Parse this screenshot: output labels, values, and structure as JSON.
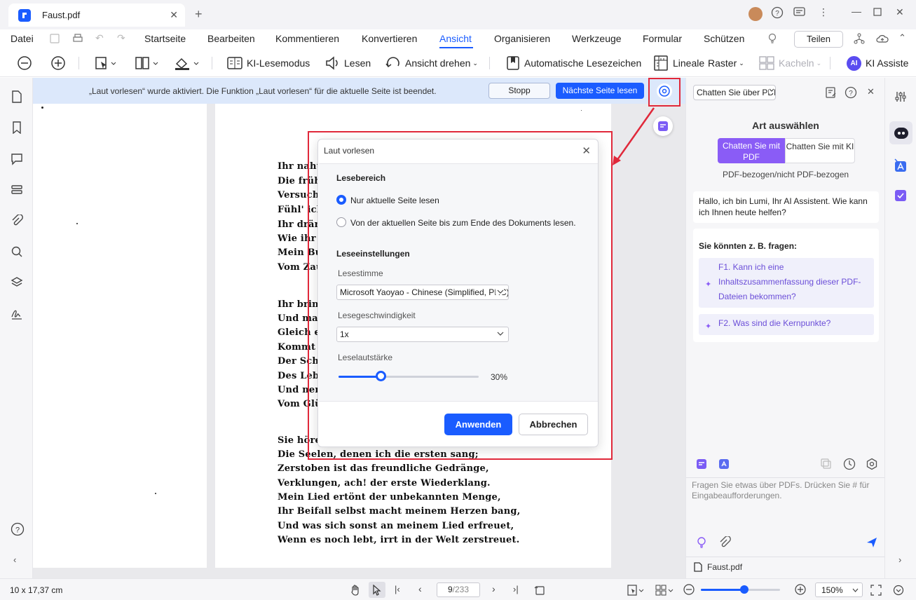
{
  "window": {
    "tab_title": "Faust.pdf",
    "accent": "#1a5cff"
  },
  "menu": {
    "file": "Datei",
    "items": [
      "Startseite",
      "Bearbeiten",
      "Kommentieren",
      "Konvertieren",
      "Ansicht",
      "Organisieren",
      "Werkzeuge",
      "Formular",
      "Schützen"
    ],
    "active": "Ansicht",
    "share": "Teilen"
  },
  "toolbar": {
    "ki_lesemodus": "KI-Lesemodus",
    "lesen": "Lesen",
    "ansicht_drehen": "Ansicht drehen",
    "auto_lesezeichen": "Automatische Lesezeichen",
    "lineale": "Lineale",
    "raster": "Raster",
    "kacheln": "Kacheln",
    "ki_assistent": "KI Assiste"
  },
  "notification": {
    "text": "„Laut vorlesen“ wurde aktiviert. Die Funktion „Laut vorlesen“ für die aktuelle Seite ist beendet.",
    "stop": "Stopp",
    "next": "Nächste Seite lesen"
  },
  "document": {
    "lines_top": [
      "Ihr naht",
      "Die früh",
      "Versuch' ich",
      "Fühl' ich",
      "Ihr dräng",
      "Wie ihr a",
      "Mein Bu",
      "Vom Zau"
    ],
    "lines_mid": [
      "Ihr bring",
      "Und manc",
      "Gleich ein",
      "Kommt e",
      "Der Schm",
      "Des Lebe",
      "Und nenn",
      "Vom Glü"
    ],
    "lines_bottom": [
      "Sie hören",
      "Die Seelen, denen ich die ersten sang;",
      "Zerstoben ist das freundliche Gedränge,",
      "Verklungen, ach! der erste Wiederklang.",
      "Mein Lied ertönt der unbekannten Menge,",
      "Ihr Beifall selbst macht meinem Herzen bang,",
      "Und was sich sonst an meinem Lied erfreuet,",
      "Wenn es noch lebt, irrt in der Welt zerstreuet."
    ]
  },
  "dialog": {
    "title": "Laut vorlesen",
    "section1": "Lesebereich",
    "radio1": "Nur aktuelle Seite lesen",
    "radio2": "Von der aktuellen Seite bis zum Ende des Dokuments lesen.",
    "section2": "Leseeinstellungen",
    "voice_label": "Lesestimme",
    "voice_value": "Microsoft Yaoyao - Chinese (Simplified, PRC)",
    "speed_label": "Lesegeschwindigkeit",
    "speed_value": "1x",
    "volume_label": "Leselautstärke",
    "volume_value": "30%",
    "volume_fraction": 0.3,
    "apply": "Anwenden",
    "cancel": "Abbrechen"
  },
  "panel": {
    "chat_select": "Chatten Sie über PDF",
    "art_title": "Art auswählen",
    "art_btn1": "Chatten Sie mit PDF",
    "art_btn2": "Chatten Sie mit KI",
    "art_sub": "PDF-bezogen/nicht PDF-bezogen",
    "greeting": "Hallo, ich bin Lumi, Ihr AI Assistent. Wie kann ich Ihnen heute helfen?",
    "suggest_title": "Sie könnten z. B. fragen:",
    "q1": "F1. Kann ich eine Inhaltszusammenfassung dieser PDF-Dateien bekommen?",
    "q2": "F2. Was sind die Kernpunkte?",
    "input_placeholder": "Fragen Sie etwas über PDFs. Drücken Sie # für Eingabeaufforderungen.",
    "file": "Faust.pdf"
  },
  "status": {
    "dims": "10 x 17,37 cm",
    "page": "9",
    "total": "/233",
    "zoom": "150%",
    "zoom_fraction": 0.55
  }
}
